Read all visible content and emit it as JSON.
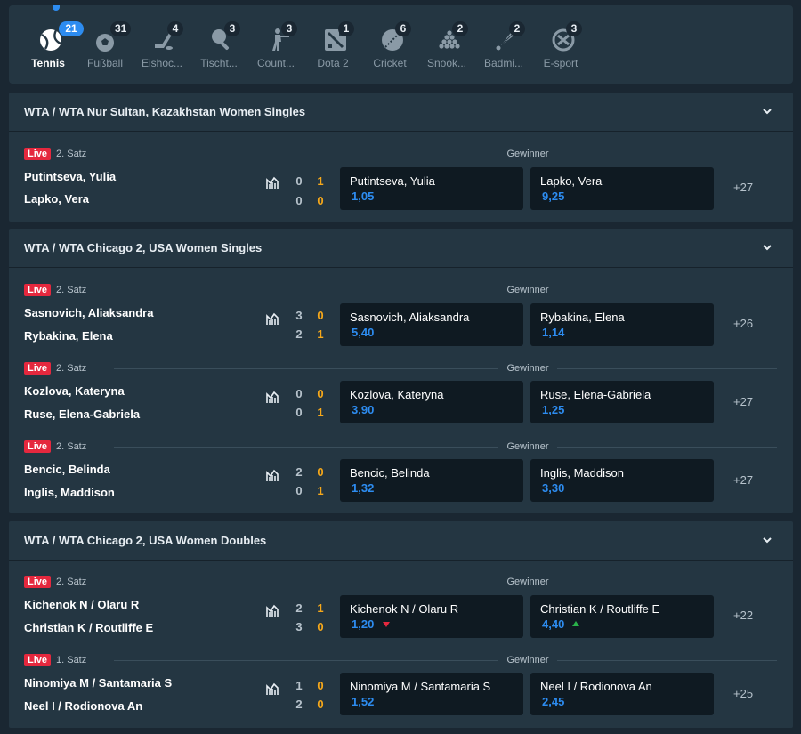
{
  "sports": [
    {
      "label": "Tennis",
      "count": "21",
      "icon": "tennis-ball-icon",
      "active": true
    },
    {
      "label": "Fußball",
      "count": "31",
      "icon": "football-icon"
    },
    {
      "label": "Eishoc...",
      "count": "4",
      "icon": "ice-hockey-icon"
    },
    {
      "label": "Tischt...",
      "count": "3",
      "icon": "table-tennis-icon"
    },
    {
      "label": "Count...",
      "count": "3",
      "icon": "counter-strike-icon"
    },
    {
      "label": "Dota 2",
      "count": "1",
      "icon": "dota-icon"
    },
    {
      "label": "Cricket",
      "count": "6",
      "icon": "cricket-icon"
    },
    {
      "label": "Snook...",
      "count": "2",
      "icon": "snooker-icon"
    },
    {
      "label": "Badmi...",
      "count": "2",
      "icon": "badminton-icon"
    },
    {
      "label": "E-sport",
      "count": "3",
      "icon": "esport-icon"
    }
  ],
  "common": {
    "live": "Live",
    "winner": "Gewinner"
  },
  "leagues": [
    {
      "title": "WTA / WTA Nur Sultan, Kazakhstan Women Singles",
      "matches": [
        {
          "period": "2. Satz",
          "p1": "Putintseva, Yulia",
          "p2": "Lapko, Vera",
          "s1": [
            "0",
            "1"
          ],
          "s2": [
            "0",
            "0"
          ],
          "o1": {
            "name": "Putintseva, Yulia",
            "price": "1,05"
          },
          "o2": {
            "name": "Lapko, Vera",
            "price": "9,25"
          },
          "more": "+27"
        }
      ]
    },
    {
      "title": "WTA / WTA Chicago 2, USA Women Singles",
      "matches": [
        {
          "period": "2. Satz",
          "p1": "Sasnovich, Aliaksandra",
          "p2": "Rybakina, Elena",
          "s1": [
            "3",
            "0"
          ],
          "s2": [
            "2",
            "1"
          ],
          "o1": {
            "name": "Sasnovich, Aliaksandra",
            "price": "5,40"
          },
          "o2": {
            "name": "Rybakina, Elena",
            "price": "1,14"
          },
          "more": "+26"
        },
        {
          "period": "2. Satz",
          "p1": "Kozlova, Kateryna",
          "p2": "Ruse, Elena-Gabriela",
          "s1": [
            "0",
            "0"
          ],
          "s2": [
            "0",
            "1"
          ],
          "o1": {
            "name": "Kozlova, Kateryna",
            "price": "3,90"
          },
          "o2": {
            "name": "Ruse, Elena-Gabriela",
            "price": "1,25"
          },
          "more": "+27"
        },
        {
          "period": "2. Satz",
          "p1": "Bencic, Belinda",
          "p2": "Inglis, Maddison",
          "s1": [
            "2",
            "0"
          ],
          "s2": [
            "0",
            "1"
          ],
          "o1": {
            "name": "Bencic, Belinda",
            "price": "1,32"
          },
          "o2": {
            "name": "Inglis, Maddison",
            "price": "3,30"
          },
          "more": "+27"
        }
      ]
    },
    {
      "title": "WTA / WTA Chicago 2, USA Women Doubles",
      "matches": [
        {
          "period": "2. Satz",
          "p1": "Kichenok N / Olaru R",
          "p2": "Christian K / Routliffe E",
          "s1": [
            "2",
            "1"
          ],
          "s2": [
            "3",
            "0"
          ],
          "o1": {
            "name": "Kichenok N / Olaru R",
            "price": "1,20",
            "trend": "down"
          },
          "o2": {
            "name": "Christian K / Routliffe E",
            "price": "4,40",
            "trend": "up"
          },
          "more": "+22"
        },
        {
          "period": "1. Satz",
          "p1": "Ninomiya M / Santamaria S",
          "p2": "Neel I / Rodionova An",
          "s1": [
            "1",
            "0"
          ],
          "s2": [
            "2",
            "0"
          ],
          "o1": {
            "name": "Ninomiya M / Santamaria S",
            "price": "1,52"
          },
          "o2": {
            "name": "Neel I / Rodionova An",
            "price": "2,45"
          },
          "more": "+25"
        }
      ]
    }
  ]
}
